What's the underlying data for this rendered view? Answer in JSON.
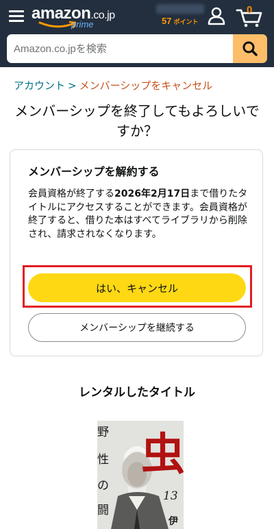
{
  "header": {
    "logo_text": "amazon",
    "logo_tld": ".co.jp",
    "logo_sub": "prime",
    "points_value": "57",
    "points_unit": "ポイント",
    "cart_count": "0",
    "colors": {
      "header_bg": "#232f3e",
      "points": "#ff9900",
      "search_button": "#febd69"
    }
  },
  "search": {
    "placeholder": "Amazon.co.jpを検索"
  },
  "breadcrumb": {
    "parent": "アカウント",
    "separator": ">",
    "current": "メンバーシップをキャンセル"
  },
  "page_title": "メンバーシップを終了してもよろしいですか？",
  "card": {
    "title": "メンバーシップを解約する",
    "body_before": "会員資格が終了する",
    "body_date": "2026年2月17日",
    "body_after": "まで借りたタイトルにアクセスすることができます。会員資格が終了すると、借りた本はすべてライブラリから削除され、請求されなくなります。",
    "confirm_button": "はい、キャンセル",
    "keep_button": "メンバーシップを継続する",
    "colors": {
      "confirm_bg": "#ffd814",
      "highlight_border": "#e31b23"
    }
  },
  "rentals": {
    "heading": "レンタルしたタイトル",
    "book": {
      "cover_text_1": "野",
      "cover_text_2": "性",
      "cover_text_3": "の",
      "cover_text_4": "闘",
      "cover_big_char": "虫",
      "cover_volume": "13",
      "cover_author": "伊藤"
    }
  }
}
